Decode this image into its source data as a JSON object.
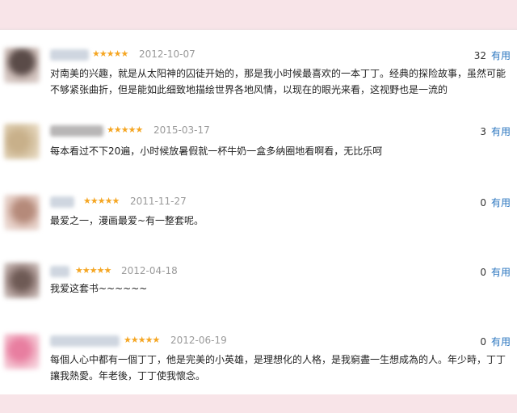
{
  "reviews": [
    {
      "username": "",
      "stars": "★★★★★",
      "date": "2012-10-07",
      "useful_count": "32",
      "useful_label": "有用",
      "text": "对南美的兴趣，就是从太阳神的囚徒开始的，那是我小时候最喜欢的一本丁丁。经典的探险故事，虽然可能\n不够紧张曲折，但是能如此细致地描绘世界各地风情，以现在的眼光来看，这视野也是一流的"
    },
    {
      "username": "",
      "stars": "★★★★★",
      "date": "2015-03-17",
      "useful_count": "3",
      "useful_label": "有用",
      "text": "每本看过不下20遍，小时候放暑假就一杯牛奶一盒多纳圈地看啊看，无比乐呵"
    },
    {
      "username": "",
      "stars": "★★★★★",
      "date": "2011-11-27",
      "useful_count": "0",
      "useful_label": "有用",
      "text": "最爱之一，漫画最爱~有一整套呢。"
    },
    {
      "username": "",
      "stars": "★★★★★",
      "date": "2012-04-18",
      "useful_count": "0",
      "useful_label": "有用",
      "text": "我爱这套书~~~~~~"
    },
    {
      "username": "",
      "stars": "★★★★★",
      "date": "2012-06-19",
      "useful_count": "0",
      "useful_label": "有用",
      "text": "每個人心中都有一個丁丁，他是完美的小英雄，是理想化的人格，是我窮盡一生想成為的人。年少時，丁丁\n讓我熱愛。年老後，丁丁使我懷念。"
    }
  ],
  "colors": {
    "star": "#f5a623",
    "useful_link": "#2a75bf",
    "page_background": "#f8e4e8"
  }
}
